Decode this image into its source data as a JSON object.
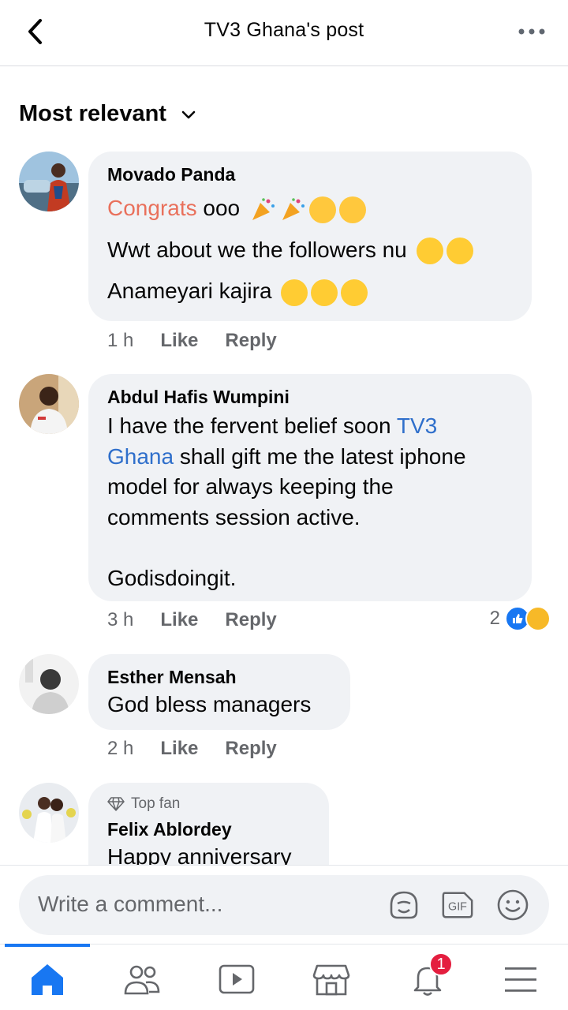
{
  "header": {
    "title": "TV3 Ghana's post"
  },
  "sort": {
    "label": "Most relevant"
  },
  "comments": [
    {
      "author": "Movado Panda",
      "lines": [
        {
          "orange": "Congrats",
          "rest": " ooo"
        },
        {
          "text": "Wwt about we the followers nu"
        },
        {
          "text": "Anameyari kajira"
        }
      ],
      "time": "1 h",
      "like": "Like",
      "reply": "Reply"
    },
    {
      "author": "Abdul Hafis Wumpini",
      "line1": "I have the fervent belief soon ",
      "link1": "TV3",
      "link2": "Ghana",
      "line2": " shall  gift me the latest iphone",
      "line3": "model for always keeping the",
      "line4": "comments session active.",
      "line5": "Godisdoingit.",
      "time": "3 h",
      "like": "Like",
      "reply": "Reply",
      "reaction_count": "2"
    },
    {
      "author": "Esther Mensah",
      "text": "God bless managers",
      "time": "2 h",
      "like": "Like",
      "reply": "Reply"
    },
    {
      "badge": "Top fan",
      "author": "Felix Ablordey",
      "text": "Happy anniversary"
    }
  ],
  "composer": {
    "placeholder": "Write a comment..."
  },
  "tabs": {
    "notification_count": "1"
  },
  "colors": {
    "accent": "#1877f2",
    "link": "#2f6fcb",
    "mention": "#e9705b",
    "bubble": "#f0f2f5"
  }
}
